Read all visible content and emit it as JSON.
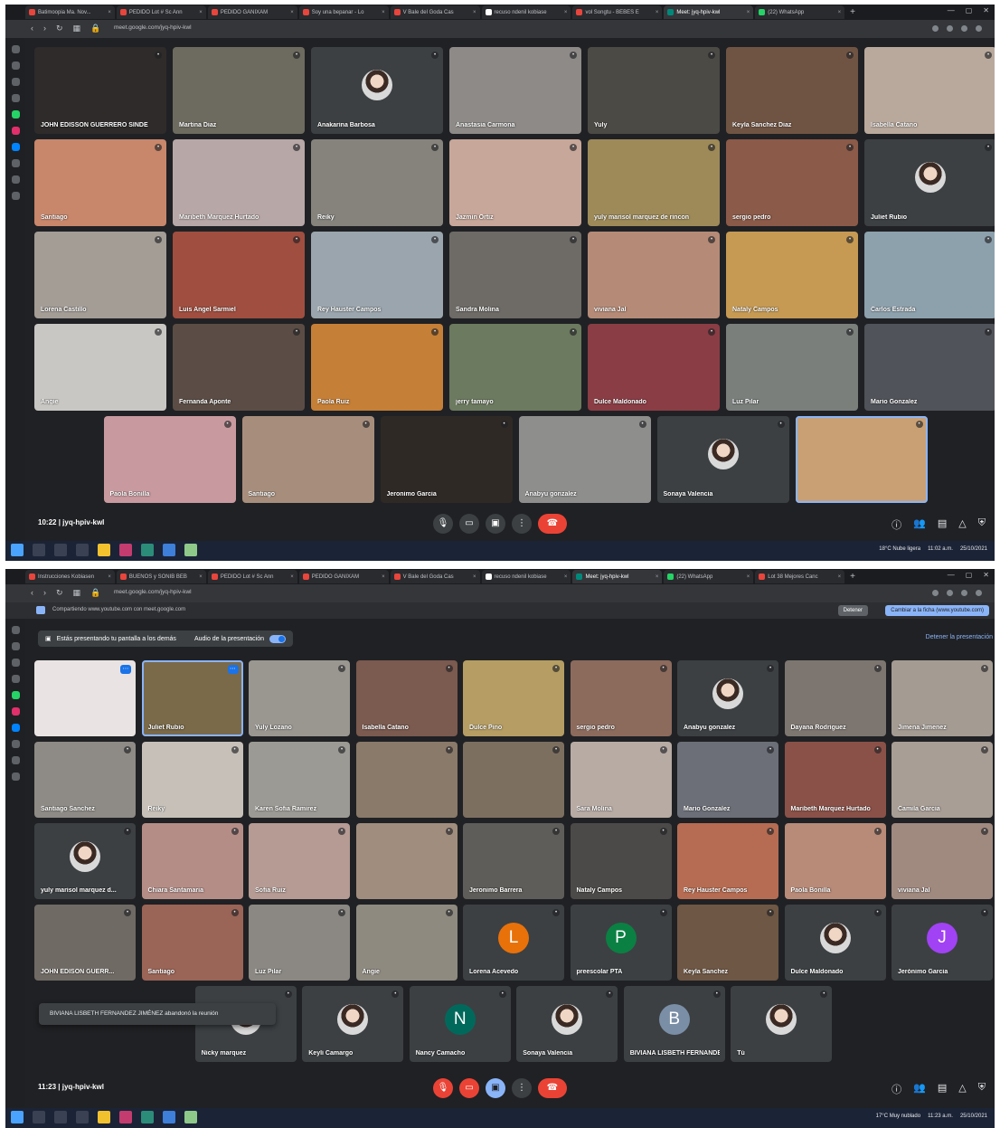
{
  "shot1": {
    "tabs": [
      {
        "label": "Batimoopia Ma. Nov...",
        "color": "#e8453c"
      },
      {
        "label": "PEDIDO Lot # Sc Ann",
        "color": "#e8453c"
      },
      {
        "label": "PEDIDO GANIXAM",
        "color": "#e8453c"
      },
      {
        "label": "Soy una bepanar - Lo",
        "color": "#e8453c"
      },
      {
        "label": "V Bale del Goda Cas",
        "color": "#e8453c"
      },
      {
        "label": "recuso ndenil kobiase",
        "color": "#ffffff"
      },
      {
        "label": "vol Songtu - BEBES E",
        "color": "#e8453c"
      },
      {
        "label": "Meet: jyq-hpiv-kwl",
        "color": "#00897b",
        "active": true
      },
      {
        "label": "(22) WhatsApp",
        "color": "#25d366"
      }
    ],
    "url": "meet.google.com/jyq-hpiv-kwl",
    "tiles": [
      [
        {
          "name": "JOHN EDISSON GUERRERO SINDE",
          "color": "#2e2b2a"
        },
        {
          "name": "Martina Diaz",
          "color": "#6d6a5f"
        },
        {
          "name": "Anakarina Barbosa",
          "color": "#3c4043",
          "photo": true
        },
        {
          "name": "Anastasia Carmona",
          "color": "#8d8a87"
        },
        {
          "name": "Yuly",
          "color": "#4c4a45"
        },
        {
          "name": "Keyla Sanchez Diaz",
          "color": "#705443"
        },
        {
          "name": "Isabella Catano",
          "color": "#b9a99c"
        }
      ],
      [
        {
          "name": "Santiago",
          "color": "#c8866b"
        },
        {
          "name": "Maribeth Marquez Hurtado",
          "color": "#b7a7a6"
        },
        {
          "name": "Reiky",
          "color": "#85837c"
        },
        {
          "name": "Jazmin Ortiz",
          "color": "#c7a79a"
        },
        {
          "name": "yuly marisol marquez de rincon",
          "color": "#9d8a58"
        },
        {
          "name": "sergio pedro",
          "color": "#8b5a48"
        },
        {
          "name": "Juliet Rubio",
          "color": "#3c4043",
          "photo": true
        }
      ],
      [
        {
          "name": "Lorena Castillo",
          "color": "#a39d96"
        },
        {
          "name": "Luis Angel Sarmiel",
          "color": "#a04e3f"
        },
        {
          "name": "Rey Hauster Campos",
          "color": "#9aa5ad"
        },
        {
          "name": "Sandra Molina",
          "color": "#6e6b67"
        },
        {
          "name": "viviana Jal",
          "color": "#b58b77"
        },
        {
          "name": "Nataly Campos",
          "color": "#c69a53"
        },
        {
          "name": "Carlos Estrada",
          "color": "#8da1ad"
        }
      ],
      [
        {
          "name": "Angie",
          "color": "#c9c7c4"
        },
        {
          "name": "Fernanda Aponte",
          "color": "#5b4d45"
        },
        {
          "name": "Paola Ruiz",
          "color": "#c57f36"
        },
        {
          "name": "jerry tamayo",
          "color": "#6c7a5f"
        },
        {
          "name": "Dulce Maldonado",
          "color": "#8a3d44"
        },
        {
          "name": "Luz Pilar",
          "color": "#7a7f7c"
        },
        {
          "name": "Mario Gonzalez",
          "color": "#51535a"
        }
      ],
      [
        {
          "name": "Paola Bonilla",
          "color": "#c89a9f"
        },
        {
          "name": "Santiago",
          "color": "#a78e7c"
        },
        {
          "name": "Jeronimo Garcia",
          "color": "#2f2926"
        },
        {
          "name": "Anabyu gonzalez",
          "color": "#8e8e8d"
        },
        {
          "name": "Sonaya Valencia",
          "color": "#3c4043",
          "photo": true
        },
        {
          "name": "",
          "color": "#c9a074",
          "highlight": true
        }
      ]
    ],
    "meeting_time": "10:22",
    "meeting_code": "jyq-hpiv-kwl",
    "taskbar_right": [
      "18°C Nube ligera",
      "11:02 a.m.",
      "25/10/2021"
    ]
  },
  "shot2": {
    "tabs": [
      {
        "label": "Instrucciones Kobiasen",
        "color": "#e8453c"
      },
      {
        "label": "BUENOS y SONIB BEB",
        "color": "#e8453c"
      },
      {
        "label": "PEDIDO Lot # Sc Ann",
        "color": "#e8453c"
      },
      {
        "label": "PEDIDO GANIXAM",
        "color": "#e8453c"
      },
      {
        "label": "V Bale del Goda Cas",
        "color": "#e8453c"
      },
      {
        "label": "recuso ndenil kobiase",
        "color": "#ffffff"
      },
      {
        "label": "Meet: jyq-hpiv-kwl",
        "color": "#00897b",
        "active": true
      },
      {
        "label": "(22) WhatsApp",
        "color": "#25d366"
      },
      {
        "label": "Lot 38 Mejores Canc",
        "color": "#e8453c"
      }
    ],
    "url": "meet.google.com/jyq-hpiv-kwl",
    "share_text": "Compartiendo www.youtube.com con meet.google.com",
    "share_stop": "Detener",
    "share_switch": "Cambiar a la ficha (www.youtube.com)",
    "presenting_text": "Estás presentando tu pantalla a los demás",
    "audio_label": "Audio de la presentación",
    "stop_presenting": "Detener la presentación",
    "tiles": [
      [
        {
          "name": "",
          "color": "#e9e4e3",
          "pin": true
        },
        {
          "name": "Juliet Rubio",
          "color": "#7a6a4a",
          "highlight": true,
          "pin": true
        },
        {
          "name": "Yuly Lozano",
          "color": "#9a9791"
        },
        {
          "name": "Isabella Catano",
          "color": "#7b5a4f"
        },
        {
          "name": "Dulce Pino",
          "color": "#b59d63"
        },
        {
          "name": "sergio pedro",
          "color": "#8c6b5d"
        },
        {
          "name": "Anabyu gonzalez",
          "color": "#3c4043",
          "photo": true
        },
        {
          "name": "Dayana Rodriguez",
          "color": "#7d7670"
        },
        {
          "name": "Jimena Jimenez",
          "color": "#a49b92"
        }
      ],
      [
        {
          "name": "Santiago Sanchez",
          "color": "#8e8b86"
        },
        {
          "name": "Reiky",
          "color": "#c6c0b8"
        },
        {
          "name": "Karen Sofia Ramirez",
          "color": "#9c9a94"
        },
        {
          "name": "",
          "color": "#8a7a6a"
        },
        {
          "name": "",
          "color": "#7d6f60"
        },
        {
          "name": "Sara Molina",
          "color": "#b7aba4"
        },
        {
          "name": "Mario Gonzalez",
          "color": "#6c6f78"
        },
        {
          "name": "Maribeth Marquez Hurtado",
          "color": "#8a5148"
        },
        {
          "name": "Camila Garcia",
          "color": "#a89e95"
        }
      ],
      [
        {
          "name": "yuly marisol marquez d...",
          "color": "#3c4043",
          "photo": true
        },
        {
          "name": "Chiara Santamaria",
          "color": "#b58d87"
        },
        {
          "name": "Sofia Ruiz",
          "color": "#b59b94"
        },
        {
          "name": "",
          "color": "#a08d7e"
        },
        {
          "name": "Jeronimo Barrera",
          "color": "#5f5d59"
        },
        {
          "name": "Nataly Campos",
          "color": "#4c4a48"
        },
        {
          "name": "Rey Hauster Campos",
          "color": "#b66c52"
        },
        {
          "name": "Paola Bonilla",
          "color": "#b78b78"
        },
        {
          "name": "viviana Jal",
          "color": "#a08a80"
        }
      ],
      [
        {
          "name": "JOHN EDISON GUERR...",
          "color": "#6f6a64"
        },
        {
          "name": "Santiago",
          "color": "#9a6457"
        },
        {
          "name": "Luz Pilar",
          "color": "#8b8883"
        },
        {
          "name": "Angie",
          "color": "#8e8a80"
        },
        {
          "name": "Lorena Acevedo",
          "color": "#3c4043",
          "avatar": "L",
          "avatar_color": "#e8710a"
        },
        {
          "name": "preescolar PTA",
          "color": "#3c4043",
          "avatar": "P",
          "avatar_color": "#0b8043"
        },
        {
          "name": "Keyla Sanchez",
          "color": "#6e5744"
        },
        {
          "name": "Dulce Maldonado",
          "color": "#3c4043",
          "photo": true
        },
        {
          "name": "Jerónimo Garcia",
          "color": "#3c4043",
          "avatar": "J",
          "avatar_color": "#a142f4"
        }
      ],
      [
        {
          "name": "Nicky marquez",
          "color": "#3c4043",
          "photo": true
        },
        {
          "name": "Keyli Camargo",
          "color": "#3c4043",
          "photo": true
        },
        {
          "name": "Nancy Camacho",
          "color": "#3c4043",
          "avatar": "N",
          "avatar_color": "#00695c"
        },
        {
          "name": "Sonaya Valencia",
          "color": "#3c4043",
          "photo": true
        },
        {
          "name": "BIVIANA LISBETH FERNANDEZ JAI...",
          "color": "#3c4043",
          "avatar": "B",
          "avatar_color": "#7a8ea6"
        },
        {
          "name": "Tú",
          "color": "#3c4043",
          "photo": true
        }
      ]
    ],
    "toast": "BIVIANA LISBETH FERNANDEZ JIMÉNEZ abandonó la reunión",
    "meeting_time": "11:23",
    "meeting_code": "jyq-hpiv-kwl",
    "taskbar_right": [
      "17°C Muy nublado",
      "11:23 a.m.",
      "25/10/2021"
    ]
  },
  "icons": {
    "mic": "mic-off-icon",
    "camera": "camera-icon",
    "present": "present-icon",
    "more": "more-options-icon",
    "hangup": "hangup-icon",
    "info": "info-icon",
    "people": "people-icon",
    "chat": "chat-icon",
    "activities": "activities-icon",
    "security": "security-icon"
  },
  "participants_badge": "49"
}
